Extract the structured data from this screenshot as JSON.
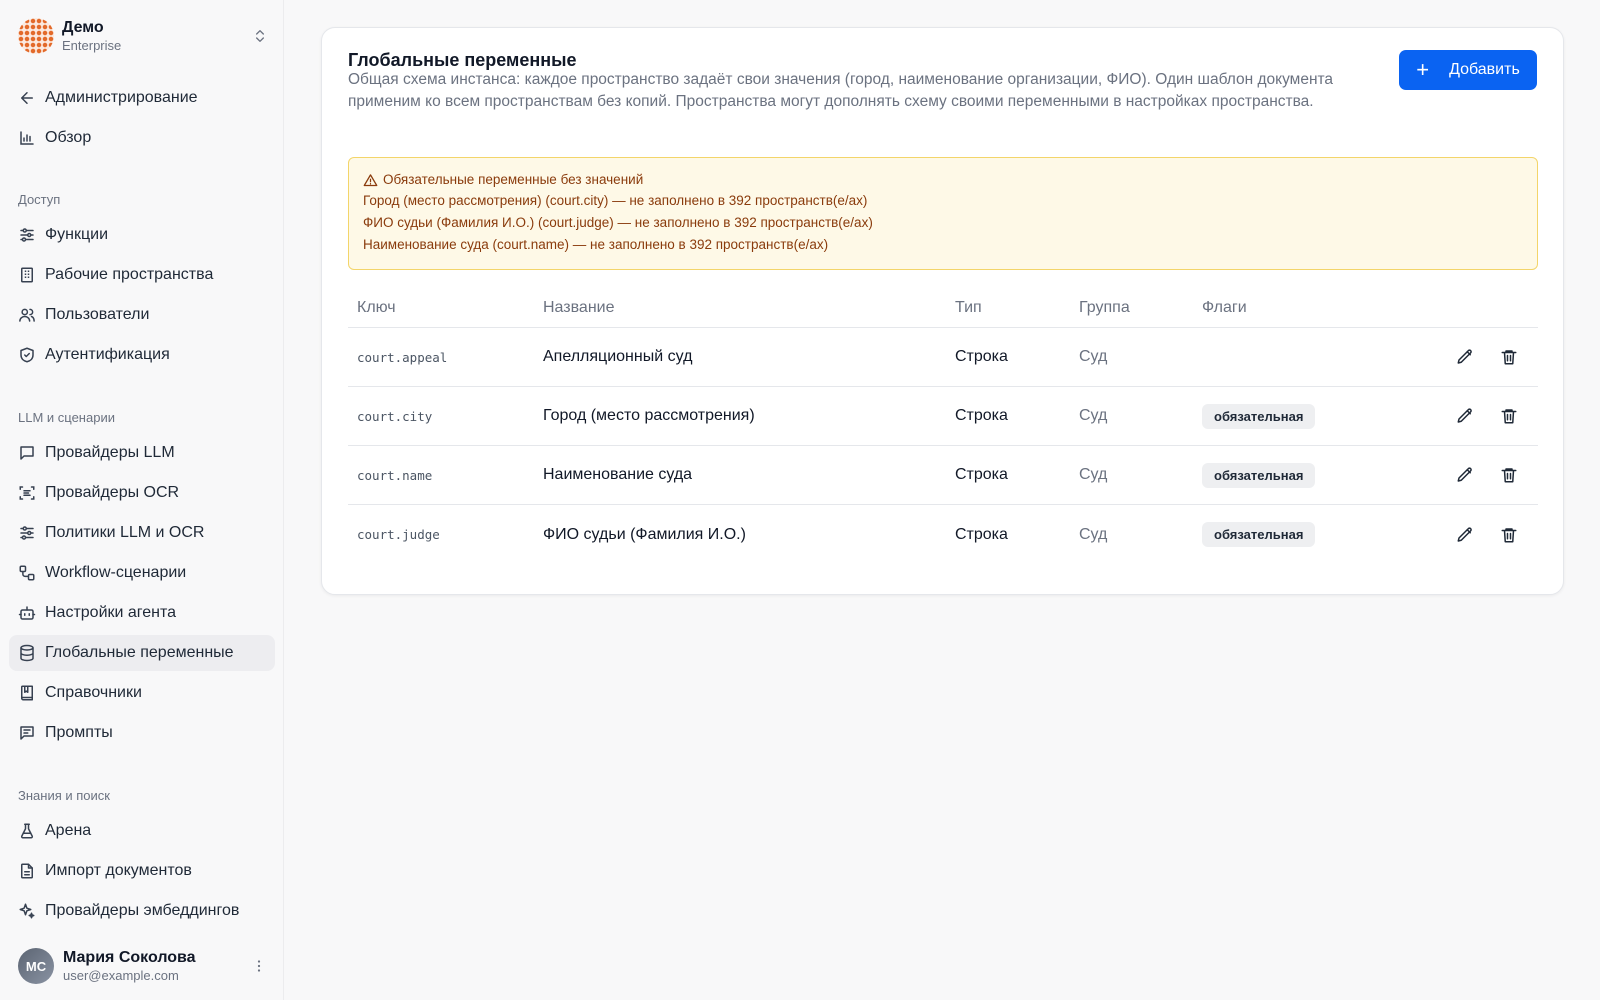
{
  "workspace": {
    "name": "Демо",
    "plan": "Enterprise"
  },
  "sidebar": {
    "back_label": "Администрирование",
    "overview_label": "Обзор",
    "sections": [
      {
        "label": "Доступ"
      },
      {
        "label": "LLM и сценарии"
      },
      {
        "label": "Знания и поиск"
      }
    ],
    "items": [
      {
        "label": "Функции"
      },
      {
        "label": "Рабочие пространства"
      },
      {
        "label": "Пользователи"
      },
      {
        "label": "Аутентификация"
      },
      {
        "label": "Провайдеры LLM"
      },
      {
        "label": "Провайдеры OCR"
      },
      {
        "label": "Политики LLM и OCR"
      },
      {
        "label": "Workflow-сценарии"
      },
      {
        "label": "Настройки агента"
      },
      {
        "label": "Глобальные переменные",
        "active": true
      },
      {
        "label": "Справочники"
      },
      {
        "label": "Промпты"
      },
      {
        "label": "Арена"
      },
      {
        "label": "Импорт документов"
      },
      {
        "label": "Провайдеры эмбеддингов"
      }
    ]
  },
  "user": {
    "initials": "МС",
    "name": "Мария Соколова",
    "email": "user@example.com"
  },
  "main": {
    "title": "Глобальные переменные",
    "description": "Общая схема инстанса: каждое пространство задаёт свои значения (город, наименование организации, ФИО). Один шаблон документа применим ко всем пространствам без копий. Пространства могут дополнять схему своими переменными в настройках пространства.",
    "add_label": "Добавить",
    "warning": {
      "title": "Обязательные переменные без значений",
      "lines": [
        "Город (место рассмотрения) (court.city) — не заполнено в 392 пространств(е/ах)",
        "ФИО судьи (Фамилия И.О.) (court.judge) — не заполнено в 392 пространств(е/ах)",
        "Наименование суда (court.name) — не заполнено в 392 пространств(е/ах)"
      ]
    },
    "table": {
      "headers": {
        "key": "Ключ",
        "name": "Название",
        "type": "Тип",
        "group": "Группа",
        "flags": "Флаги"
      },
      "rows": [
        {
          "key": "court.appeal",
          "name": "Апелляционный суд",
          "type": "Строка",
          "group": "Суд",
          "flag": ""
        },
        {
          "key": "court.city",
          "name": "Город (место рассмотрения)",
          "type": "Строка",
          "group": "Суд",
          "flag": "обязательная"
        },
        {
          "key": "court.name",
          "name": "Наименование суда",
          "type": "Строка",
          "group": "Суд",
          "flag": "обязательная"
        },
        {
          "key": "court.judge",
          "name": "ФИО судьи (Фамилия И.О.)",
          "type": "Строка",
          "group": "Суд",
          "flag": "обязательная"
        }
      ]
    }
  },
  "colors": {
    "accent": "#0a63f2",
    "warning_bg": "#fef9e7",
    "warning_border": "#f3d56a",
    "warning_text": "#8a3b0c"
  }
}
